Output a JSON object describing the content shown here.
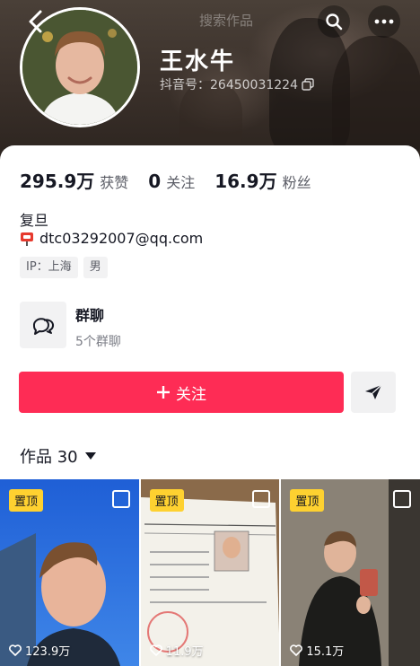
{
  "profile": {
    "name": "王水牛",
    "douyin_id": "抖音号：26450031224",
    "search_hint": "搜索作品"
  },
  "stats": [
    {
      "value": "295.9万",
      "label": "获赞"
    },
    {
      "value": "0",
      "label": "关注"
    },
    {
      "value": "16.9万",
      "label": "粉丝"
    }
  ],
  "bio": {
    "school": "复旦",
    "email": "dtc03292007@qq.com"
  },
  "tags": [
    "IP：上海",
    "男"
  ],
  "group": {
    "title": "群聊",
    "subtitle": "5个群聊"
  },
  "actions": {
    "follow_label": "关注"
  },
  "works": {
    "tab_label": "作品 30"
  },
  "videos": [
    {
      "pinned": "置顶",
      "likes": "123.9万"
    },
    {
      "pinned": "置顶",
      "likes": "11.9万"
    },
    {
      "pinned": "置顶",
      "likes": "15.1万"
    }
  ],
  "colors": {
    "accent": "#fe2c55",
    "pin_badge": "#fed130",
    "text_primary": "#161823",
    "text_secondary": "#5b5d66"
  },
  "icons": {
    "back": "chevron-left-icon",
    "search": "search-icon",
    "more": "more-icon",
    "copy": "copy-icon",
    "mail": "mailbox-icon",
    "group": "chat-bubbles-icon",
    "share": "send-icon",
    "dropdown": "caret-down-icon",
    "like": "heart-icon",
    "multi": "multi-photo-icon"
  }
}
